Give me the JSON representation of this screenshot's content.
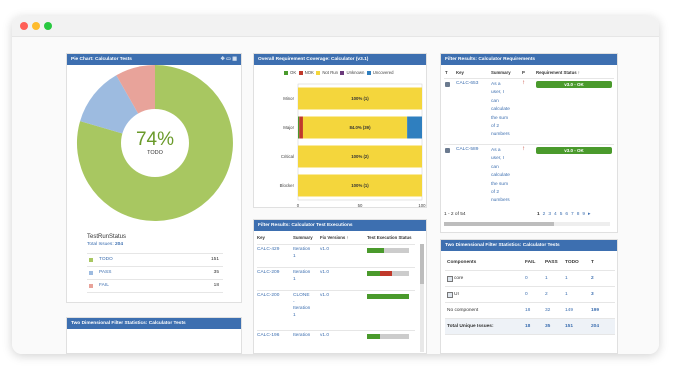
{
  "window": {
    "dots": [
      "#ff5f57",
      "#febc2e",
      "#28c840"
    ]
  },
  "pie_gadget": {
    "title": "Pie Chart: Calculator Tests",
    "percent": "74%",
    "center_label": "TODO",
    "field_title": "TestRunStatus",
    "total_label": "Total Issues:",
    "total_value": "204",
    "legend": [
      {
        "label": "TODO",
        "value": "151",
        "color": "#a8c761"
      },
      {
        "label": "PASS",
        "value": "35",
        "color": "#9dbbe0"
      },
      {
        "label": "FAIL",
        "value": "18",
        "color": "#e8a39a"
      }
    ]
  },
  "coverage_gadget": {
    "title": "Overall Requirement Coverage: Calculator (v3.1)",
    "legend": [
      {
        "label": "OK",
        "color": "#4a9a2c"
      },
      {
        "label": "NOK",
        "color": "#c0392b"
      },
      {
        "label": "Not Run",
        "color": "#f4d63c"
      },
      {
        "label": "Unknown",
        "color": "#6b3a7c"
      },
      {
        "label": "Uncovered",
        "color": "#2f7fbf"
      }
    ],
    "rows": [
      {
        "label": "Minor",
        "text": "100% (1)"
      },
      {
        "label": "Major",
        "text": "84.0% (39)"
      },
      {
        "label": "Critical",
        "text": "100% (2)"
      },
      {
        "label": "Blocker",
        "text": "100% (1)"
      }
    ],
    "x_ticks": [
      "0",
      "50",
      "100"
    ]
  },
  "chart_data": {
    "type": "bar",
    "orientation": "horizontal",
    "stacked": true,
    "categories": [
      "Minor",
      "Major",
      "Critical",
      "Blocker"
    ],
    "xlim": [
      0,
      100
    ],
    "series": [
      {
        "name": "OK",
        "values": [
          0,
          1,
          0,
          0
        ]
      },
      {
        "name": "NOK",
        "values": [
          0,
          3,
          0,
          0
        ]
      },
      {
        "name": "Not Run",
        "values": [
          100,
          84,
          100,
          100
        ]
      },
      {
        "name": "Unknown",
        "values": [
          0,
          0,
          0,
          0
        ]
      },
      {
        "name": "Uncovered",
        "values": [
          0,
          12,
          0,
          0
        ]
      }
    ],
    "data_labels": [
      "100% (1)",
      "84.0% (39)",
      "100% (2)",
      "100% (1)"
    ]
  },
  "executions_gadget": {
    "title": "Filter Results: Calculator Test Executions",
    "headers": [
      "Key",
      "Summary",
      "Fix Versions",
      "Test Execution Status"
    ],
    "rows": [
      {
        "key": "CALC-429",
        "summary": [
          "Iteration",
          "1"
        ],
        "fix": "v1.0",
        "status": [
          {
            "color": "#4a9a2c",
            "pct": 40
          },
          {
            "color": "#cccccc",
            "pct": 60
          }
        ]
      },
      {
        "key": "CALC-209",
        "summary": [
          "Iteration",
          "1"
        ],
        "fix": "v1.0",
        "status": [
          {
            "color": "#4a9a2c",
            "pct": 30
          },
          {
            "color": "#c0392b",
            "pct": 30
          },
          {
            "color": "#cccccc",
            "pct": 40
          }
        ]
      },
      {
        "key": "CALC-200",
        "summary": [
          "CLONE",
          "-",
          "Iteration",
          "1"
        ],
        "fix": "v1.0",
        "status": [
          {
            "color": "#4a9a2c",
            "pct": 100
          }
        ]
      },
      {
        "key": "CALC-196",
        "summary": [
          "Iteration"
        ],
        "fix": "v1.0",
        "status": [
          {
            "color": "#4a9a2c",
            "pct": 30
          },
          {
            "color": "#cccccc",
            "pct": 70
          }
        ]
      }
    ]
  },
  "requirements_gadget": {
    "title": "Filter Results: Calculator Requirements",
    "headers": [
      "T",
      "Key",
      "Summary",
      "P",
      "Requirement Status"
    ],
    "rows": [
      {
        "key": "CALC-653",
        "summary": [
          "As a",
          "user, I",
          "can",
          "calculate",
          "the sum",
          "of 2",
          "numbers"
        ],
        "status": "v3.0 - OK"
      },
      {
        "key": "CALC-589",
        "summary": [
          "As a",
          "user, I",
          "can",
          "calculate",
          "the sum",
          "of 2",
          "numbers"
        ],
        "status": "v3.0 - OK"
      }
    ],
    "pager_text": "1 - 2 of 54",
    "pages": [
      "1",
      "2",
      "3",
      "4",
      "5",
      "6",
      "7",
      "8",
      "9"
    ]
  },
  "twodim_right": {
    "title": "Two Dimensional Filter Statistics: Calculator Tests",
    "headers": [
      "Components",
      "FAIL",
      "PASS",
      "TODO",
      "T"
    ],
    "rows": [
      {
        "name": "core",
        "fail": "0",
        "pass": "1",
        "todo": "1",
        "t": "2"
      },
      {
        "name": "UI",
        "fail": "0",
        "pass": "2",
        "todo": "1",
        "t": "3"
      },
      {
        "name": "No component",
        "fail": "18",
        "pass": "32",
        "todo": "149",
        "t": "199"
      }
    ],
    "total": {
      "name": "Total Unique Issues:",
      "fail": "18",
      "pass": "35",
      "todo": "151",
      "t": "204"
    }
  },
  "twodim_left": {
    "title": "Two Dimensional Filter Statistics: Calculator Tests"
  }
}
